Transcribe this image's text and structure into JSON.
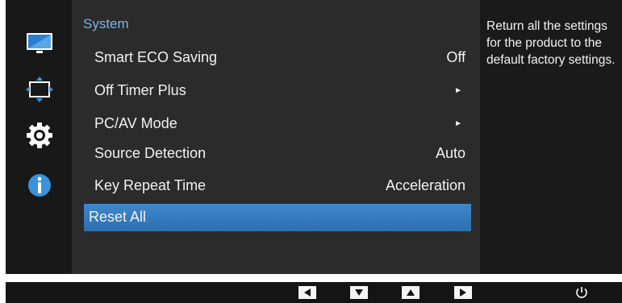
{
  "colors": {
    "accent": "#7fb2e5",
    "selection": "#3a80c4",
    "panel": "#2b2b2b",
    "background": "#121212"
  },
  "sidebar": {
    "icons": [
      {
        "name": "picture-icon"
      },
      {
        "name": "onscreen-display-icon"
      },
      {
        "name": "settings-gear-icon"
      },
      {
        "name": "information-icon"
      }
    ]
  },
  "menu": {
    "title": "System",
    "items": [
      {
        "label": "Smart ECO Saving",
        "value": "Off"
      },
      {
        "label": "Off Timer Plus",
        "value": "►"
      },
      {
        "label": "PC/AV Mode",
        "value": "►"
      },
      {
        "label": "Source Detection",
        "value": "Auto"
      },
      {
        "label": "Key Repeat Time",
        "value": "Acceleration"
      },
      {
        "label": "Reset All",
        "value": ""
      }
    ],
    "selected_index": 5
  },
  "help": {
    "text": "Return all the settings for the product to the default factory settings."
  },
  "bottom_bar": {
    "buttons": [
      {
        "name": "left-arrow-button"
      },
      {
        "name": "down-arrow-button"
      },
      {
        "name": "up-arrow-button"
      },
      {
        "name": "right-arrow-button"
      },
      {
        "name": "power-button"
      }
    ]
  }
}
